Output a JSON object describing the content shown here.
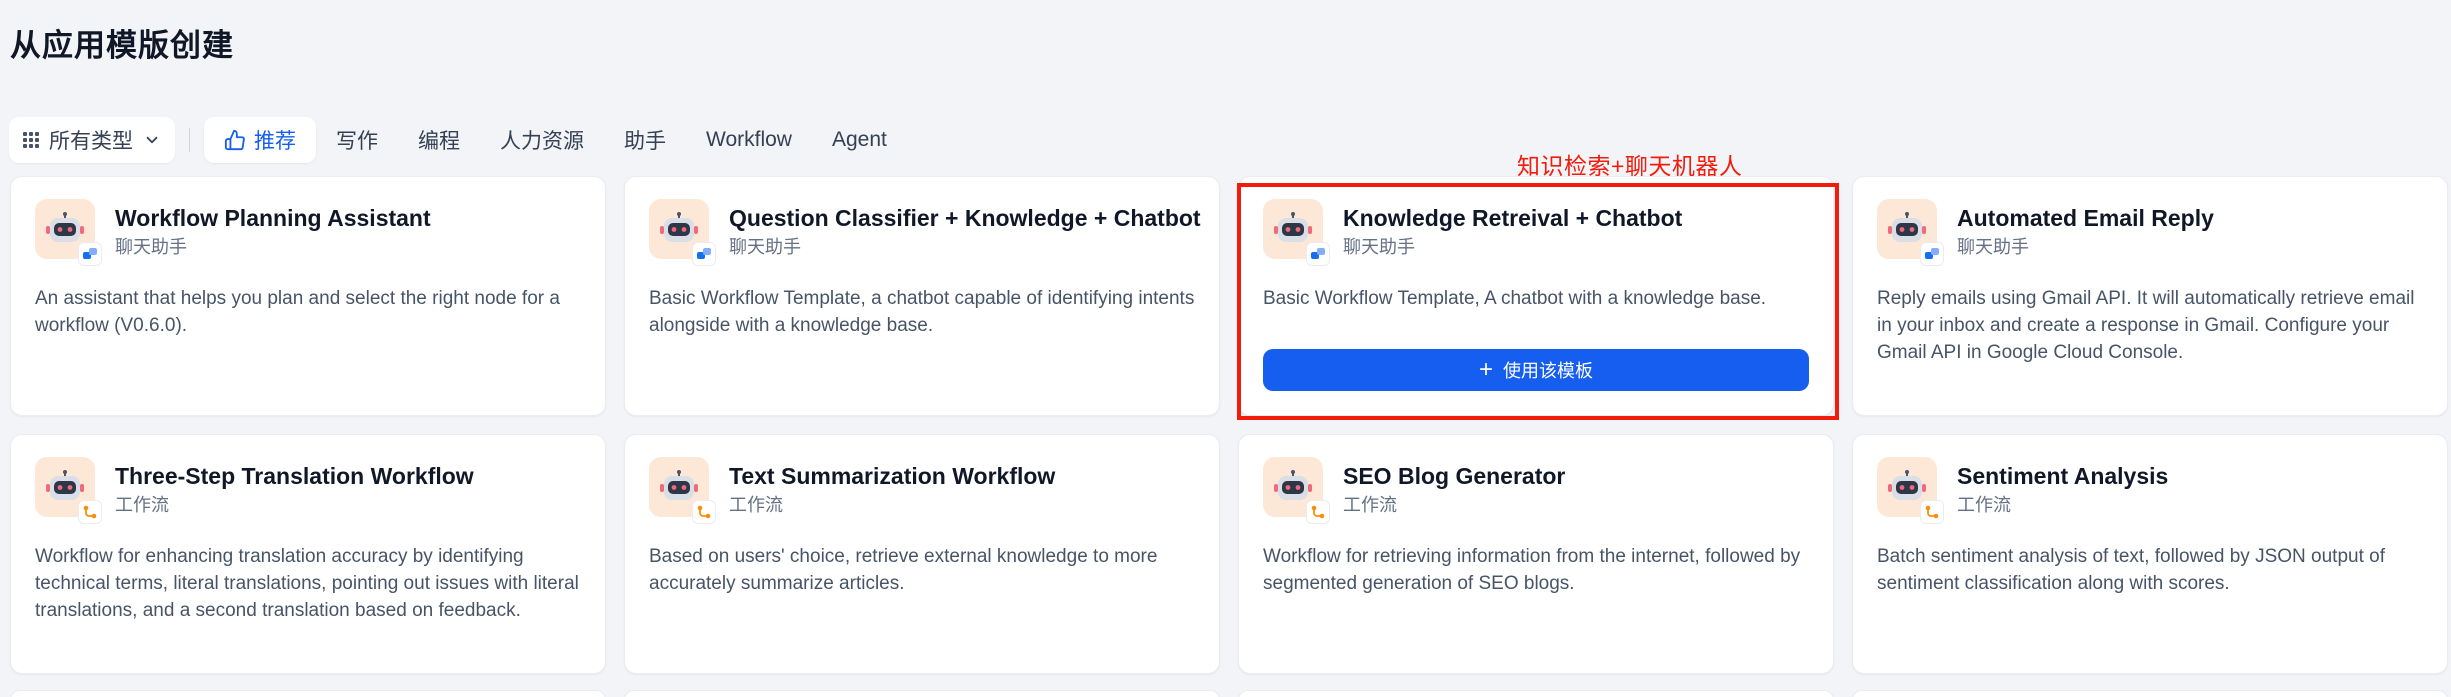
{
  "page_title": "从应用模版创建",
  "filter": {
    "type_select_label": "所有类型",
    "tabs": [
      {
        "label": "推荐"
      },
      {
        "label": "写作"
      },
      {
        "label": "编程"
      },
      {
        "label": "人力资源"
      },
      {
        "label": "助手"
      },
      {
        "label": "Workflow"
      },
      {
        "label": "Agent"
      }
    ]
  },
  "annotation": {
    "label": "知识检索+聊天机器人",
    "color": "#f21c0d"
  },
  "use_template_label": "使用该模板",
  "cards": [
    {
      "title": "Workflow Planning Assistant",
      "mode": "聊天助手",
      "description": "An assistant that helps you plan and select the right node for a workflow (V0.6.0)."
    },
    {
      "title": "Question Classifier + Knowledge + Chatbot",
      "mode": "聊天助手",
      "description": "Basic Workflow Template, a chatbot capable of identifying intents alongside with a knowledge base."
    },
    {
      "title": "Knowledge Retreival + Chatbot",
      "mode": "聊天助手",
      "description": "Basic Workflow Template, A chatbot with a knowledge base."
    },
    {
      "title": "Automated Email Reply",
      "mode": "聊天助手",
      "description": "Reply emails using Gmail API. It will automatically retrieve email in your inbox and create a response in Gmail. Configure your Gmail API in Google Cloud Console."
    },
    {
      "title": "Three-Step Translation Workflow",
      "mode": "工作流",
      "description": "Workflow for enhancing translation accuracy by identifying technical terms, literal translations, pointing out issues with literal translations, and a second translation based on feedback."
    },
    {
      "title": "Text Summarization Workflow",
      "mode": "工作流",
      "description": "Based on users' choice, retrieve external knowledge to more accurately summarize articles."
    },
    {
      "title": "SEO Blog Generator",
      "mode": "工作流",
      "description": "Workflow for retrieving information from the internet, followed by segmented generation of SEO blogs."
    },
    {
      "title": "Sentiment Analysis",
      "mode": "工作流",
      "description": "Batch sentiment analysis of text, followed by JSON output of sentiment classification along with scores."
    }
  ],
  "colors": {
    "accent": "#155eef",
    "page_bg": "#f2f4f7",
    "avatar_bg": "#fde7d7",
    "chat_badge": "#1570ef",
    "workflow_badge": "#f79009"
  },
  "icons": {
    "avatar": "robot-icon",
    "chat_mode": "chat-bubble-icon",
    "workflow_mode": "workflow-icon",
    "type_select": "grid-icon",
    "recommend_tab": "thumbs-up-icon"
  }
}
